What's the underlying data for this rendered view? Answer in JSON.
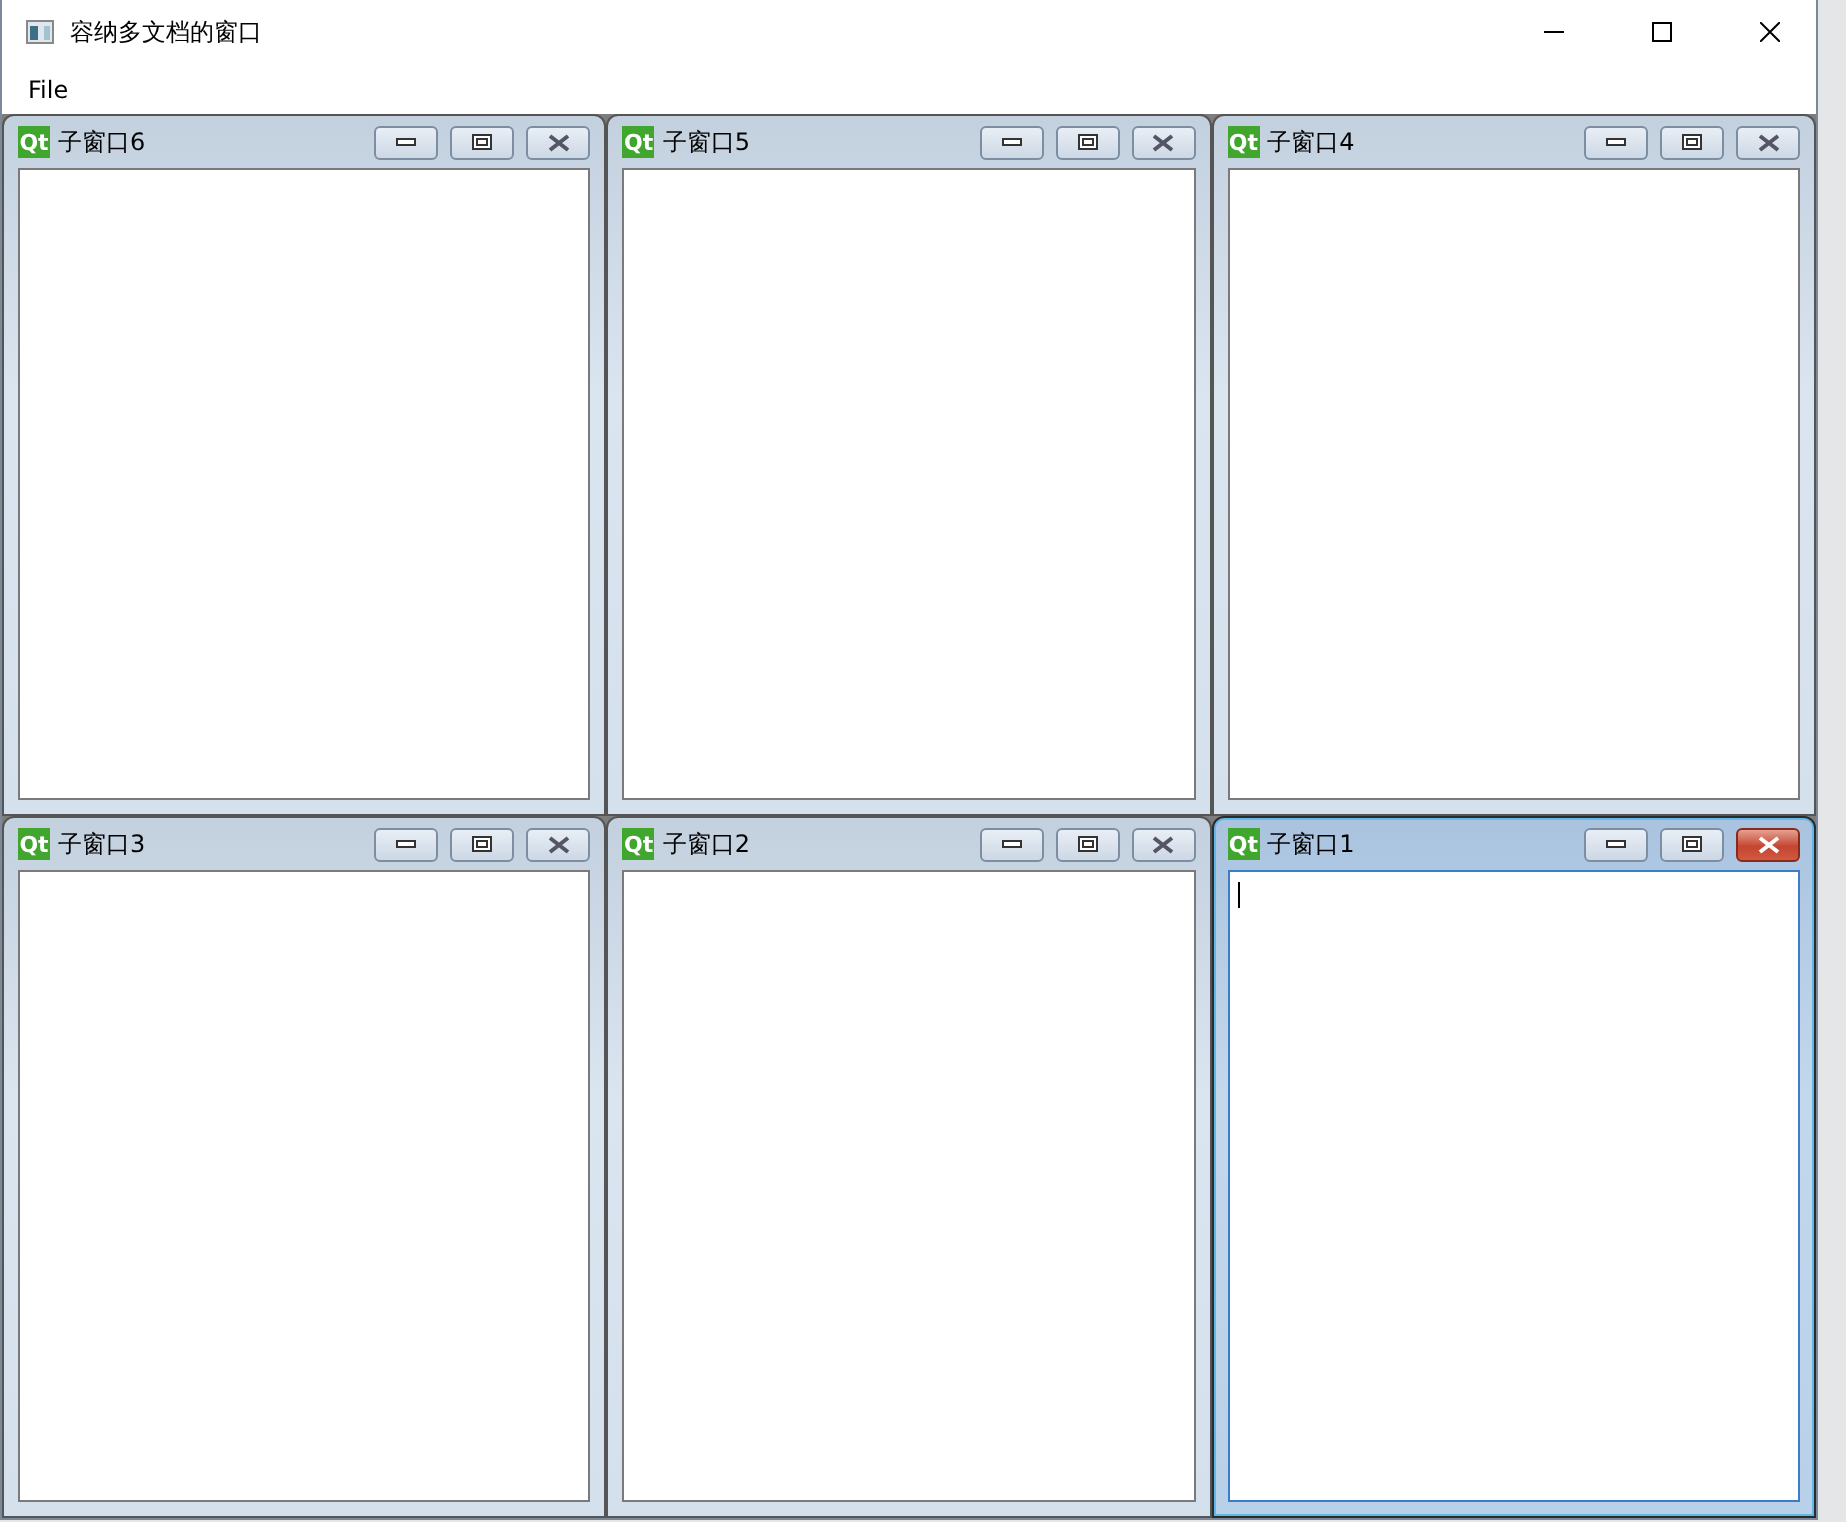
{
  "window": {
    "title": "容纳多文档的窗口"
  },
  "menu": [
    "File"
  ],
  "subwindows": [
    {
      "title": "子窗口6",
      "logo": "Qt",
      "selected": false
    },
    {
      "title": "子窗口5",
      "logo": "Qt",
      "selected": false
    },
    {
      "title": "子窗口4",
      "logo": "Qt",
      "selected": false
    },
    {
      "title": "子窗口3",
      "logo": "Qt",
      "selected": false
    },
    {
      "title": "子窗口2",
      "logo": "Qt",
      "selected": false
    },
    {
      "title": "子窗口1",
      "logo": "Qt",
      "selected": true
    }
  ]
}
